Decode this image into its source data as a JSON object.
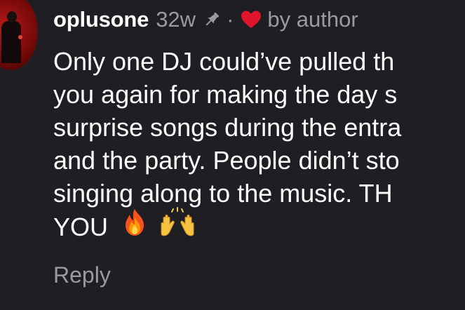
{
  "comment": {
    "username": "oplusone",
    "age": "32w",
    "separator": "·",
    "liked_by": "by author",
    "text_lines": [
      "Only one DJ could’ve pulled th",
      "you again for making the day s",
      "surprise songs during the entra",
      "and the party. People didn’t sto",
      "singing along to the music. TH",
      "YOU"
    ],
    "emojis": [
      "fire-emoji",
      "raised-hands-emoji"
    ],
    "reply_label": "Reply"
  },
  "colors": {
    "background": "#1f1f23",
    "text": "#ffffff",
    "muted": "#9a9aa1",
    "heart": "#e0152c"
  },
  "icons": [
    "avatar",
    "pin-icon",
    "heart-icon",
    "fire-emoji",
    "raised-hands-emoji"
  ]
}
